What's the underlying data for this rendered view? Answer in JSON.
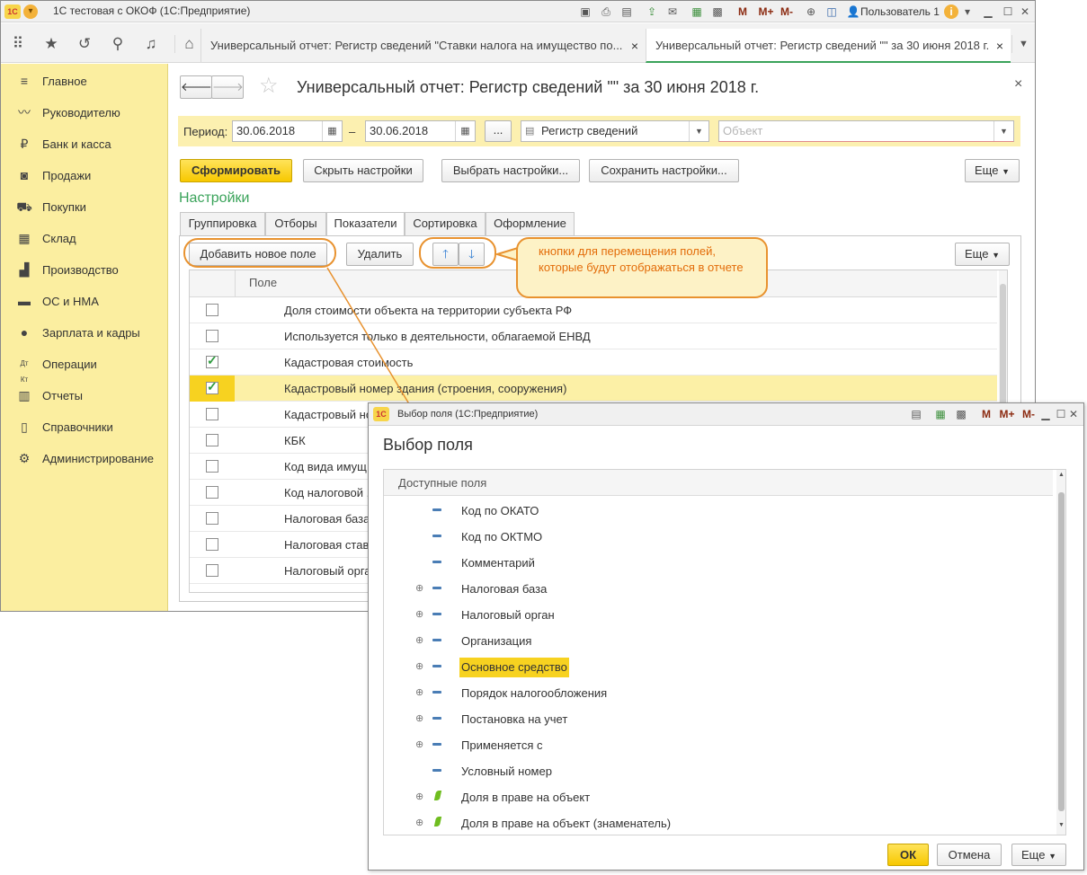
{
  "main_window": {
    "title": "1С тестовая с ОКОФ  (1С:Предприятие)",
    "user": "Пользователь 1",
    "toolbar_letters": [
      "M",
      "M+",
      "M-"
    ]
  },
  "tabs": [
    {
      "label": "Универсальный отчет: Регистр сведений \"Ставки налога на имущество по...",
      "active": false
    },
    {
      "label": "Универсальный отчет: Регистр сведений \"\" за 30 июня 2018 г.",
      "active": true
    }
  ],
  "sidebar": {
    "items": [
      {
        "label": "Главное",
        "icon": "menu-icon"
      },
      {
        "label": "Руководителю",
        "icon": "chart-line-icon"
      },
      {
        "label": "Банк и касса",
        "icon": "ruble-icon"
      },
      {
        "label": "Продажи",
        "icon": "bag-icon"
      },
      {
        "label": "Покупки",
        "icon": "cart-icon"
      },
      {
        "label": "Склад",
        "icon": "warehouse-icon"
      },
      {
        "label": "Производство",
        "icon": "factory-icon"
      },
      {
        "label": "ОС и НМА",
        "icon": "truck-icon"
      },
      {
        "label": "Зарплата и кадры",
        "icon": "person-icon"
      },
      {
        "label": "Операции",
        "icon": "dt-kt-icon"
      },
      {
        "label": "Отчеты",
        "icon": "bar-chart-icon"
      },
      {
        "label": "Справочники",
        "icon": "book-icon"
      },
      {
        "label": "Администрирование",
        "icon": "gear-icon"
      }
    ]
  },
  "report": {
    "title": "Универсальный отчет: Регистр сведений \"\" за 30 июня 2018 г.",
    "period_label": "Период:",
    "date_from": "30.06.2018",
    "date_sep": "–",
    "date_to": "30.06.2018",
    "ellipsis": "...",
    "source_value": "Регистр сведений",
    "object_placeholder": "Объект",
    "buttons": {
      "generate": "Сформировать",
      "hide_settings": "Скрыть настройки",
      "choose_settings": "Выбрать настройки...",
      "save_settings": "Сохранить настройки...",
      "more": "Еще"
    },
    "settings_title": "Настройки",
    "settings_tabs": [
      "Группировка",
      "Отборы",
      "Показатели",
      "Сортировка",
      "Оформление"
    ],
    "active_tab": "Показатели",
    "grid_buttons": {
      "add_field": "Добавить новое поле",
      "delete": "Удалить",
      "more": "Еще"
    },
    "grid_header": "Поле",
    "rows": [
      {
        "text": "Доля стоимости объекта на территории субъекта РФ",
        "checked": false,
        "selected": false
      },
      {
        "text": "Используется только в деятельности, облагаемой ЕНВД",
        "checked": false,
        "selected": false
      },
      {
        "text": "Кадастровая стоимость",
        "checked": true,
        "selected": false
      },
      {
        "text": "Кадастровый номер здания (строения, сооружения)",
        "checked": true,
        "selected": true
      },
      {
        "text": "Кадастровый но",
        "checked": false,
        "selected": false
      },
      {
        "text": "КБК",
        "checked": false,
        "selected": false
      },
      {
        "text": "Код вида имущ",
        "checked": false,
        "selected": false
      },
      {
        "text": "Код налоговой ,",
        "checked": false,
        "selected": false
      },
      {
        "text": "Налоговая база",
        "checked": false,
        "selected": false
      },
      {
        "text": "Налоговая став",
        "checked": false,
        "selected": false
      },
      {
        "text": "Налоговый орга",
        "checked": false,
        "selected": false
      }
    ]
  },
  "callout": {
    "text": "кнопки для перемещения полей, которые будут отображаться в отчете"
  },
  "dialog": {
    "window_title": "Выбор поля  (1С:Предприятие)",
    "heading": "Выбор поля",
    "list_header": "Доступные поля",
    "items": [
      {
        "text": "Код по ОКАТО",
        "expandable": false,
        "kind": "field",
        "highlight": false
      },
      {
        "text": "Код по ОКТМО",
        "expandable": false,
        "kind": "field",
        "highlight": false
      },
      {
        "text": "Комментарий",
        "expandable": false,
        "kind": "field",
        "highlight": false
      },
      {
        "text": "Налоговая база",
        "expandable": true,
        "kind": "field",
        "highlight": false
      },
      {
        "text": "Налоговый орган",
        "expandable": true,
        "kind": "field",
        "highlight": false
      },
      {
        "text": "Организация",
        "expandable": true,
        "kind": "field",
        "highlight": false
      },
      {
        "text": "Основное средство",
        "expandable": true,
        "kind": "field",
        "highlight": true
      },
      {
        "text": "Порядок налогообложения",
        "expandable": true,
        "kind": "field",
        "highlight": false
      },
      {
        "text": "Постановка на учет",
        "expandable": true,
        "kind": "field",
        "highlight": false
      },
      {
        "text": "Применяется с",
        "expandable": true,
        "kind": "field",
        "highlight": false
      },
      {
        "text": "Условный номер",
        "expandable": false,
        "kind": "field",
        "highlight": false
      },
      {
        "text": "Доля в праве на объект",
        "expandable": true,
        "kind": "resource",
        "highlight": false
      },
      {
        "text": "Доля в праве на объект (знаменатель)",
        "expandable": true,
        "kind": "resource",
        "highlight": false
      }
    ],
    "buttons": {
      "ok": "ОК",
      "cancel": "Отмена",
      "more": "Еще"
    },
    "toolbar_letters": [
      "M",
      "M+",
      "M-"
    ]
  },
  "colors": {
    "sidebar_bg": "#fbeea0",
    "accent_yellow": "#f7c800",
    "callout_orange": "#e8922f",
    "settings_green": "#3aa35a"
  }
}
